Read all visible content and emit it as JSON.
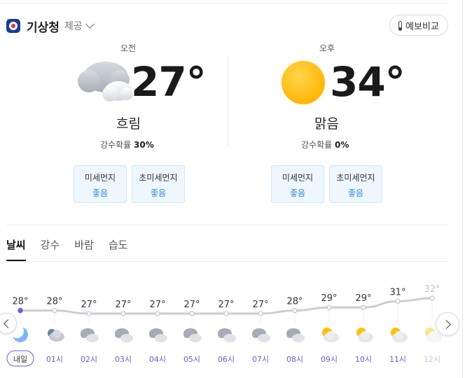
{
  "provider": {
    "name": "기상청",
    "suffix": "제공",
    "logo_icon": "kma-logo-icon"
  },
  "compare_button": {
    "label": "예보비교",
    "icon": "thermometer-icon"
  },
  "am": {
    "period": "오전",
    "temp": "27°",
    "condition": "흐림",
    "precip_label": "강수확률",
    "precip_value": "30%",
    "icon": "cloudy-icon",
    "dust": [
      {
        "label": "미세먼지",
        "value": "좋음"
      },
      {
        "label": "초미세먼지",
        "value": "좋음"
      }
    ]
  },
  "pm": {
    "period": "오후",
    "temp": "34°",
    "condition": "맑음",
    "precip_label": "강수확률",
    "precip_value": "0%",
    "icon": "sunny-icon",
    "dust": [
      {
        "label": "미세먼지",
        "value": "좋음"
      },
      {
        "label": "초미세먼지",
        "value": "좋음"
      }
    ]
  },
  "tabs": [
    {
      "label": "날씨",
      "active": true
    },
    {
      "label": "강수",
      "active": false
    },
    {
      "label": "바람",
      "active": false
    },
    {
      "label": "습도",
      "active": false
    }
  ],
  "chart_data": {
    "type": "line",
    "x": [
      "내일",
      "01시",
      "02시",
      "03시",
      "04시",
      "05시",
      "06시",
      "07시",
      "08시",
      "09시",
      "10시",
      "11시",
      "12시"
    ],
    "values": [
      28,
      28,
      27,
      27,
      27,
      27,
      27,
      27,
      28,
      29,
      29,
      31,
      32
    ],
    "value_labels": [
      "28°",
      "28°",
      "27°",
      "27°",
      "27°",
      "27°",
      "27°",
      "27°",
      "28°",
      "29°",
      "29°",
      "31°",
      "32°"
    ],
    "icons": [
      "night-partly-cloudy-icon",
      "night-cloudy-icon",
      "cloudy-icon",
      "cloudy-icon",
      "cloudy-icon",
      "cloudy-icon",
      "cloudy-icon",
      "cloudy-icon",
      "cloudy-icon",
      "partly-sunny-icon",
      "partly-sunny-icon",
      "partly-sunny-icon",
      "partly-sunny-icon"
    ],
    "highlighted_label": "내일",
    "line_color": "#c9ced6",
    "accent_color": "#6f5bd6"
  },
  "colors": {
    "brand": "#1a3f8f",
    "accent": "#6f5bd6",
    "dust_good": "#2e86de",
    "sun": "#ffc107"
  }
}
